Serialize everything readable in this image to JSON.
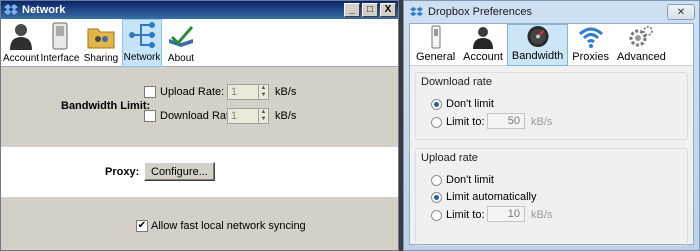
{
  "left_window": {
    "title": "Network",
    "controls": [
      "_",
      "□",
      "X"
    ],
    "tabs": [
      {
        "label": "Account",
        "icon": "person-icon"
      },
      {
        "label": "Interface",
        "icon": "toggle-switch-icon"
      },
      {
        "label": "Sharing",
        "icon": "shared-folder-icon"
      },
      {
        "label": "Network",
        "icon": "network-icon",
        "active": true
      },
      {
        "label": "About",
        "icon": "about-icon"
      }
    ],
    "bandwidth": {
      "label": "Bandwidth Limit:",
      "upload_label": "Upload Rate:",
      "upload_value": "1",
      "upload_checked": false,
      "download_label": "Download Rate:",
      "download_value": "1",
      "download_checked": false,
      "unit": "kB/s"
    },
    "proxy": {
      "label": "Proxy:",
      "button": "Configure..."
    },
    "sync": {
      "label": "Allow fast local network syncing",
      "checked": true
    }
  },
  "right_window": {
    "title": "Dropbox Preferences",
    "close_glyph": "✕",
    "tabs": [
      {
        "label": "General",
        "icon": "switch-icon"
      },
      {
        "label": "Account",
        "icon": "person-icon"
      },
      {
        "label": "Bandwidth",
        "icon": "speedometer-icon",
        "active": true
      },
      {
        "label": "Proxies",
        "icon": "wifi-icon"
      },
      {
        "label": "Advanced",
        "icon": "gears-icon"
      }
    ],
    "download": {
      "title": "Download rate",
      "option1": "Don't limit",
      "option2": "Limit to:",
      "value": "50",
      "unit": "kB/s",
      "selected": "dont_limit"
    },
    "upload": {
      "title": "Upload rate",
      "option1": "Don't limit",
      "option2": "Limit automatically",
      "option3": "Limit to:",
      "value": "10",
      "unit": "kB/s",
      "selected": "limit_automatically"
    }
  }
}
